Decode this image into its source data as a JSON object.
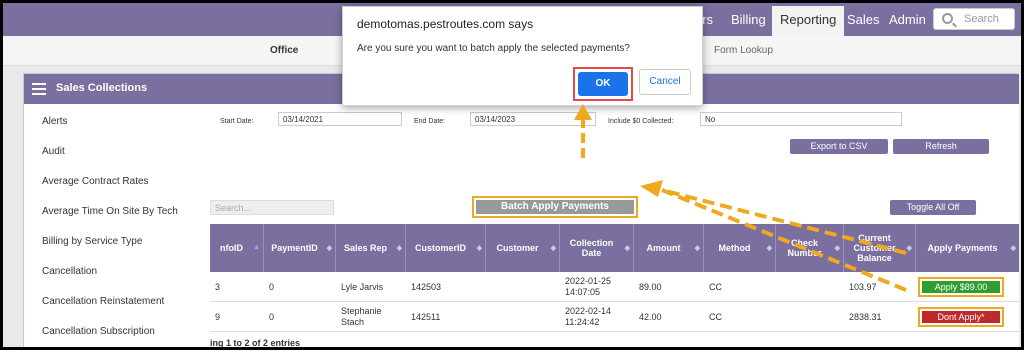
{
  "nav": {
    "items": [
      "ers",
      "Billing",
      "Reporting",
      "Sales",
      "Admin"
    ],
    "search_placeholder": "Search"
  },
  "subnav": {
    "office": "Office",
    "form_lookup": "Form Lookup"
  },
  "panel": {
    "title": "Sales Collections"
  },
  "sidebar": {
    "items": [
      "Alerts",
      "Audit",
      "Average Contract Rates",
      "Average Time On Site By Tech",
      "Billing by Service Type",
      "Cancellation",
      "Cancellation Reinstatement",
      "Cancellation Subscription"
    ]
  },
  "filters": {
    "start_label": "Start Date:",
    "start_value": "03/14/2021",
    "end_label": "End Date:",
    "end_value": "03/14/2023",
    "include_label": "Include $0 Collected:",
    "include_value": "No",
    "export_label": "Export to CSV",
    "refresh_label": "Refresh",
    "search_placeholder": "Search...",
    "batch_label": "Batch Apply Payments",
    "toggle_label": "Toggle All Off"
  },
  "table": {
    "headers": [
      "nfoID",
      "PaymentID",
      "Sales Rep",
      "CustomerID",
      "Customer",
      "Collection Date",
      "Amount",
      "Method",
      "Check Number",
      "Current Customer Balance",
      "Apply Payments"
    ],
    "rows": [
      {
        "infoid": "3",
        "paymentid": "0",
        "rep": "Lyle Jarvis",
        "customerid": "142503",
        "customer": "",
        "date": "2022-01-25 14:07:05",
        "amount": "89.00",
        "method": "CC",
        "check": "",
        "balance": "103.97",
        "action": "Apply $89.00"
      },
      {
        "infoid": "9",
        "paymentid": "0",
        "rep": "Stephanie Stach",
        "customerid": "142511",
        "customer": "",
        "date": "2022-02-14 11:24:42",
        "amount": "42.00",
        "method": "CC",
        "check": "",
        "balance": "2838.31",
        "action": "Dont Apply*"
      }
    ],
    "showing": "ing 1 to 2 of 2 entries"
  },
  "dialog": {
    "title": "demotomas.pestroutes.com says",
    "message": "Are you sure you want to batch apply the selected payments?",
    "ok_label": "OK",
    "cancel_label": "Cancel"
  },
  "colors": {
    "brand": "#7b6fa0",
    "highlight": "#f0a81c",
    "ok_blue": "#1a73e8",
    "apply_green": "#2e9e2e",
    "dont_red": "#c0282b"
  }
}
